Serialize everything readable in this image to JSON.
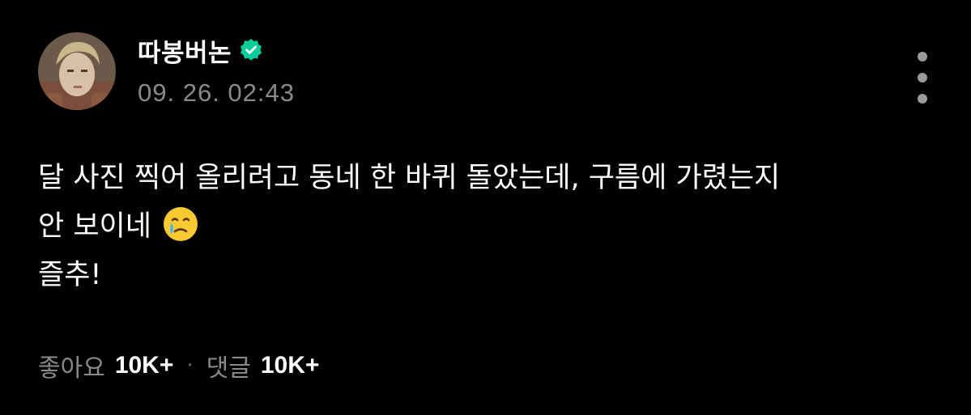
{
  "post": {
    "author": {
      "name": "따봉버논",
      "verified": true,
      "avatar_icon": "profile-photo",
      "verified_icon": "verified-badge-icon"
    },
    "timestamp": "09. 26. 02:43",
    "more_icon": "more-vertical-icon",
    "body": {
      "line1": "달 사진 찍어 올리려고 동네 한 바퀴 돌았는데, 구름에 가렸는지",
      "line2": "안 보이네",
      "line2_emoji": "face-holding-back-tears",
      "line3": "즐추!"
    },
    "stats": {
      "likes_label": "좋아요",
      "likes_count": "10K+",
      "separator": "·",
      "comments_label": "댓글",
      "comments_count": "10K+"
    }
  },
  "colors": {
    "background": "#000000",
    "text": "#ffffff",
    "muted": "#8a8a8a",
    "verified": "#08cc99"
  }
}
